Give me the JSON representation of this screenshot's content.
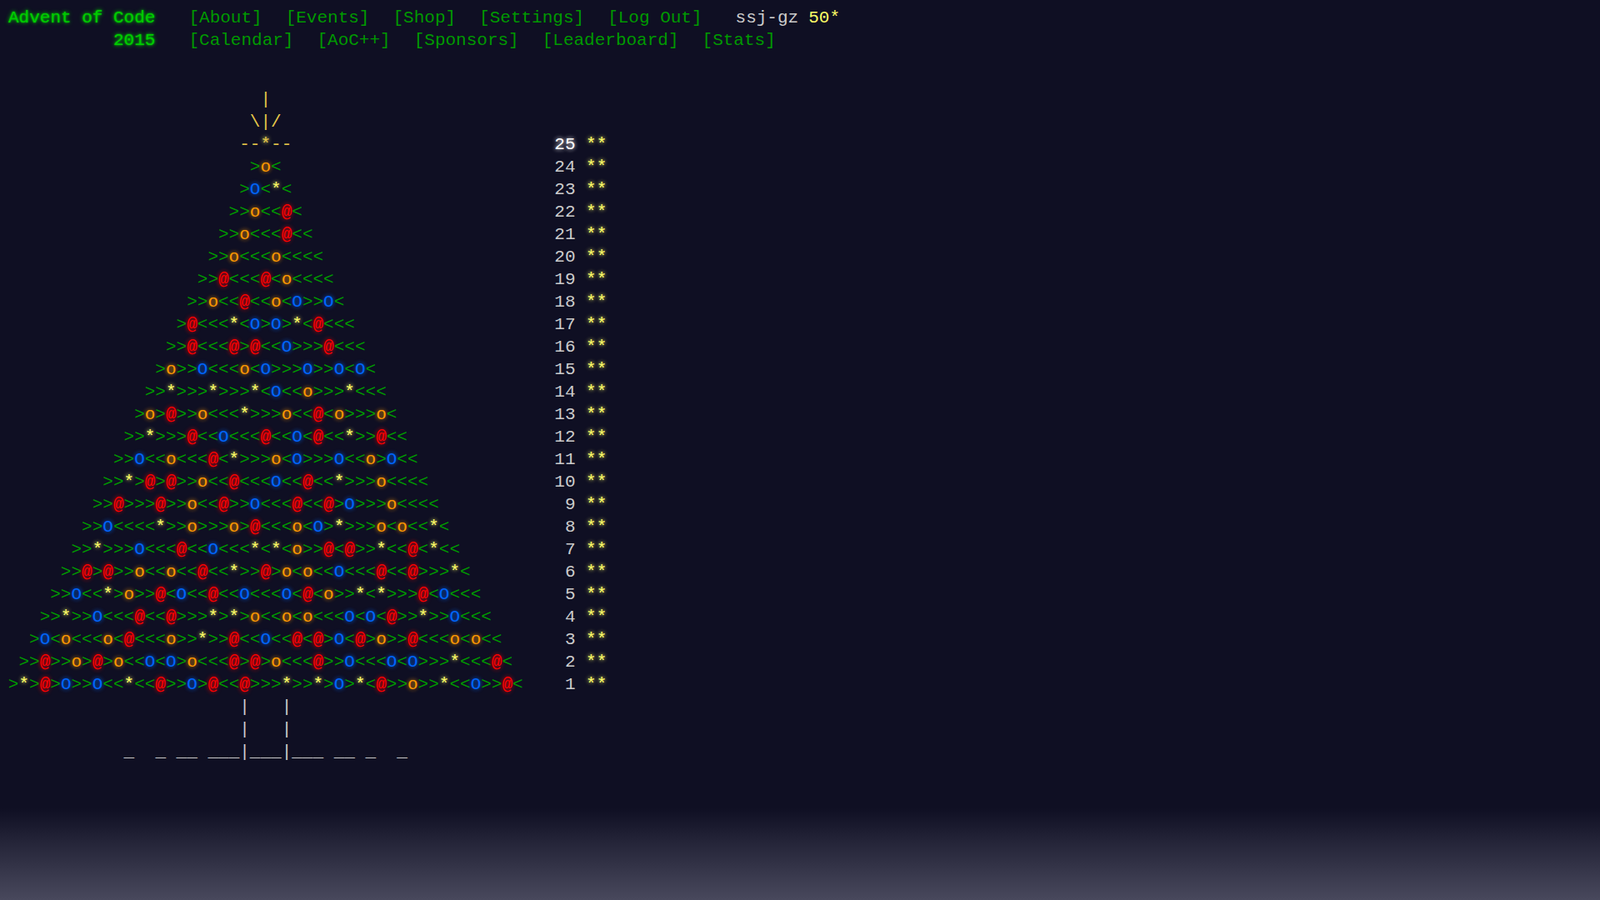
{
  "header": {
    "title": "Advent of Code",
    "year": "2015",
    "nav": [
      "[About]",
      "[Events]",
      "[Shop]",
      "[Settings]",
      "[Log Out]"
    ],
    "nav2": [
      "[Calendar]",
      "[AoC++]",
      "[Sponsors]",
      "[Leaderboard]",
      "[Stats]"
    ],
    "user": "ssj-gz",
    "star_count": "50*"
  },
  "tree": {
    "top": [
      "|",
      "\\|/"
    ],
    "rows": [
      {
        "day": "25",
        "art": "--*--",
        "stars_text": "**",
        "current": true
      },
      {
        "day": "24",
        "art": ">o<",
        "stars_text": "**",
        "current": false
      },
      {
        "day": "23",
        "art": ">O<*<",
        "stars_text": "**",
        "current": false
      },
      {
        "day": "22",
        "art": ">>o<<@<",
        "stars_text": "**",
        "current": false
      },
      {
        "day": "21",
        "art": ">>o<<<@<<",
        "stars_text": "**",
        "current": false
      },
      {
        "day": "20",
        "art": ">>o<<<o<<<<",
        "stars_text": "**",
        "current": false
      },
      {
        "day": "19",
        "art": ">>@<<<@<o<<<<",
        "stars_text": "**",
        "current": false
      },
      {
        "day": "18",
        "art": ">>o<<@<<o<O>>O<",
        "stars_text": "**",
        "current": false
      },
      {
        "day": "17",
        "art": ">@<<<*<O>O>*<@<<<",
        "stars_text": "**",
        "current": false
      },
      {
        "day": "16",
        "art": ">>@<<<@>@<<O>>>@<<<",
        "stars_text": "**",
        "current": false
      },
      {
        "day": "15",
        "art": ">o>>O<<<o<O>>>O>>O<O<",
        "stars_text": "**",
        "current": false
      },
      {
        "day": "14",
        "art": ">>*>>>*>>>*<O<<o>>>*<<<",
        "stars_text": "**",
        "current": false
      },
      {
        "day": "13",
        "art": ">o>@>>o<<<*>>>o<<@<o>>>o<",
        "stars_text": "**",
        "current": false
      },
      {
        "day": "12",
        "art": ">>*>>>@<<O<<<@<<O<@<<*>>@<<",
        "stars_text": "**",
        "current": false
      },
      {
        "day": "11",
        "art": ">>O<<o<<<@<*>>>o<O>>>O<<o>O<<",
        "stars_text": "**",
        "current": false
      },
      {
        "day": "10",
        "art": ">>*>@>@>>o<<@<<<O<<@<<*>>>o<<<<",
        "stars_text": "**",
        "current": false
      },
      {
        "day": "9",
        "art": ">>@>>>@>>o<<@>>O<<<@<<@>O>>>o<<<<",
        "stars_text": "**",
        "current": false
      },
      {
        "day": "8",
        "art": ">>O<<<<*>>o>>>o>@<<<o<O>*>>>o<o<<*<",
        "stars_text": "**",
        "current": false
      },
      {
        "day": "7",
        "art": ">>*>>>O<<<@<<O<<<*<*<o>>@<@>>*<<@<*<<",
        "stars_text": "**",
        "current": false
      },
      {
        "day": "6",
        "art": ">>@>@>>o<<o<<@<<*>>@>o<o<<O<<<@<<@>>>*<",
        "stars_text": "**",
        "current": false
      },
      {
        "day": "5",
        "art": ">>O<<*>o>>@<O<<@<<O<<<O<@<o>>*<*>>>@<O<<<",
        "stars_text": "**",
        "current": false
      },
      {
        "day": "4",
        "art": ">>*>>O<<<@<<@>>>*>*>o<<o<o<<<O<O<@>>*>>O<<<",
        "stars_text": "**",
        "current": false
      },
      {
        "day": "3",
        "art": ">O<o<<<o<@<<<o>>*>>@<<O<<@<@>O<@>o>>@<<<o<o<<",
        "stars_text": "**",
        "current": false
      },
      {
        "day": "2",
        "art": ">>@>>o>@>o<<O<O>o<<<@>@>o<<<@>>O<<<O<O>>>*<<<@<",
        "stars_text": "**",
        "current": false
      },
      {
        "day": "1",
        "art": ">*>@>O>>O<<*<<@>>O>@<<@>>>*>>*>O>*<@>>o>>*<<O>>@<",
        "stars_text": "**",
        "current": false
      }
    ],
    "trunk": [
      "|   |",
      "|   |",
      "_  _ __ ___|___|___ __ _  _"
    ]
  }
}
